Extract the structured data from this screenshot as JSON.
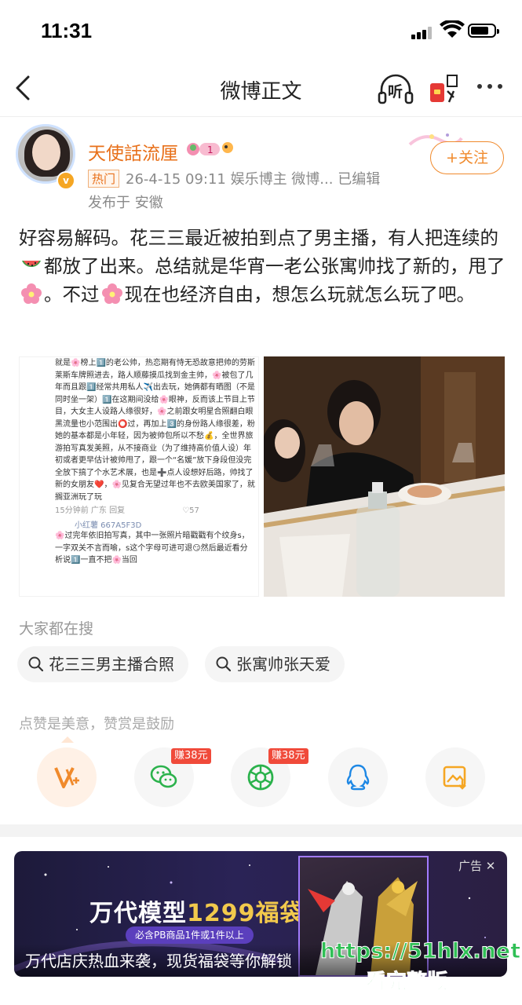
{
  "status_bar": {
    "time": "11:31"
  },
  "nav": {
    "title": "微博正文",
    "listen_label": "听"
  },
  "author": {
    "name": "天使話流厘",
    "tag": "热门",
    "meta": "26-4-15 09:11 娱乐博主 微博... 已编辑",
    "location": "发布于 安徽",
    "follow_label": "+关注"
  },
  "post": {
    "seg1": "好容易解码。花三三最近被拍到点了男主播，有人把连续的",
    "seg2": "都放了出来。总结就是华宵一老公张寓帅找了新的，甩了",
    "seg3": "。不过",
    "seg4": "现在也经济自由，想怎么玩就怎么玩了吧。"
  },
  "screenshot_text": {
    "body": "就是🌸榜上1️⃣的老公帅，热恋期有恃无恐故意把帅的劳斯莱斯车牌照进去，路人顺藤摸瓜找到金主帅，🌸被包了几年而且跟1️⃣经常共用私人✈️出去玩，她俩都有晒图（不是同时坐一架）1️⃣在这期间没给🌸眼神，反而该上节目上节目，大女主人设路人缘很好，🌸之前跟女明星合照翻白眼黑流量也小范围出⭕过，再加上3️⃣的身份路人缘很差，粉她的基本都是小年轻，因为被帅包所以不愁💰，全世界旅游拍写真发美照，从不接商业（为了维持高价值人设）年初或者更早估计被帅甩了，跟一个“名媛”放下身段但没完全放下搞了个水艺术展，也是➕点人设想好后路，帅找了新的女朋友❤️，🌸见复合无望过年也不去欧美国家了，就搁亚洲玩了玩",
    "footer": "15分钟前 广东  回复",
    "likes": "57",
    "reply_user": "小红薯 667A5F3D",
    "reply_body": "🌸过完年依旧拍写真，其中一张照片暗戳戳有个纹身s，一字双关不言而喻，s这个字母可进可退😏然后最近看分析说1️⃣一直不把🌸当回"
  },
  "hot_search": {
    "title": "大家都在搜",
    "chips": [
      "花三三男主播合照",
      "张寓帅张天爱"
    ]
  },
  "reward": {
    "title": "点赞是美意，赞赏是鼓励",
    "buttons": [
      {
        "icon": "reward-v-icon"
      },
      {
        "icon": "wechat-icon",
        "badge": "赚38元"
      },
      {
        "icon": "moments-icon",
        "badge": "赚38元"
      },
      {
        "icon": "qq-icon"
      },
      {
        "icon": "save-image-icon"
      }
    ]
  },
  "ad": {
    "label": "广告",
    "brand_a": "万代模型",
    "brand_b": "1299福袋",
    "sub": "必含PB商品1件或1件以上",
    "caption": "万代店庆热血来袭，现货福袋等你解锁"
  },
  "watermark": {
    "url": "https://51hlx.net",
    "text": "看完整版"
  },
  "colors": {
    "accent": "#f08a2c",
    "name": "#e8701a",
    "badge_red": "#f04a3a"
  }
}
